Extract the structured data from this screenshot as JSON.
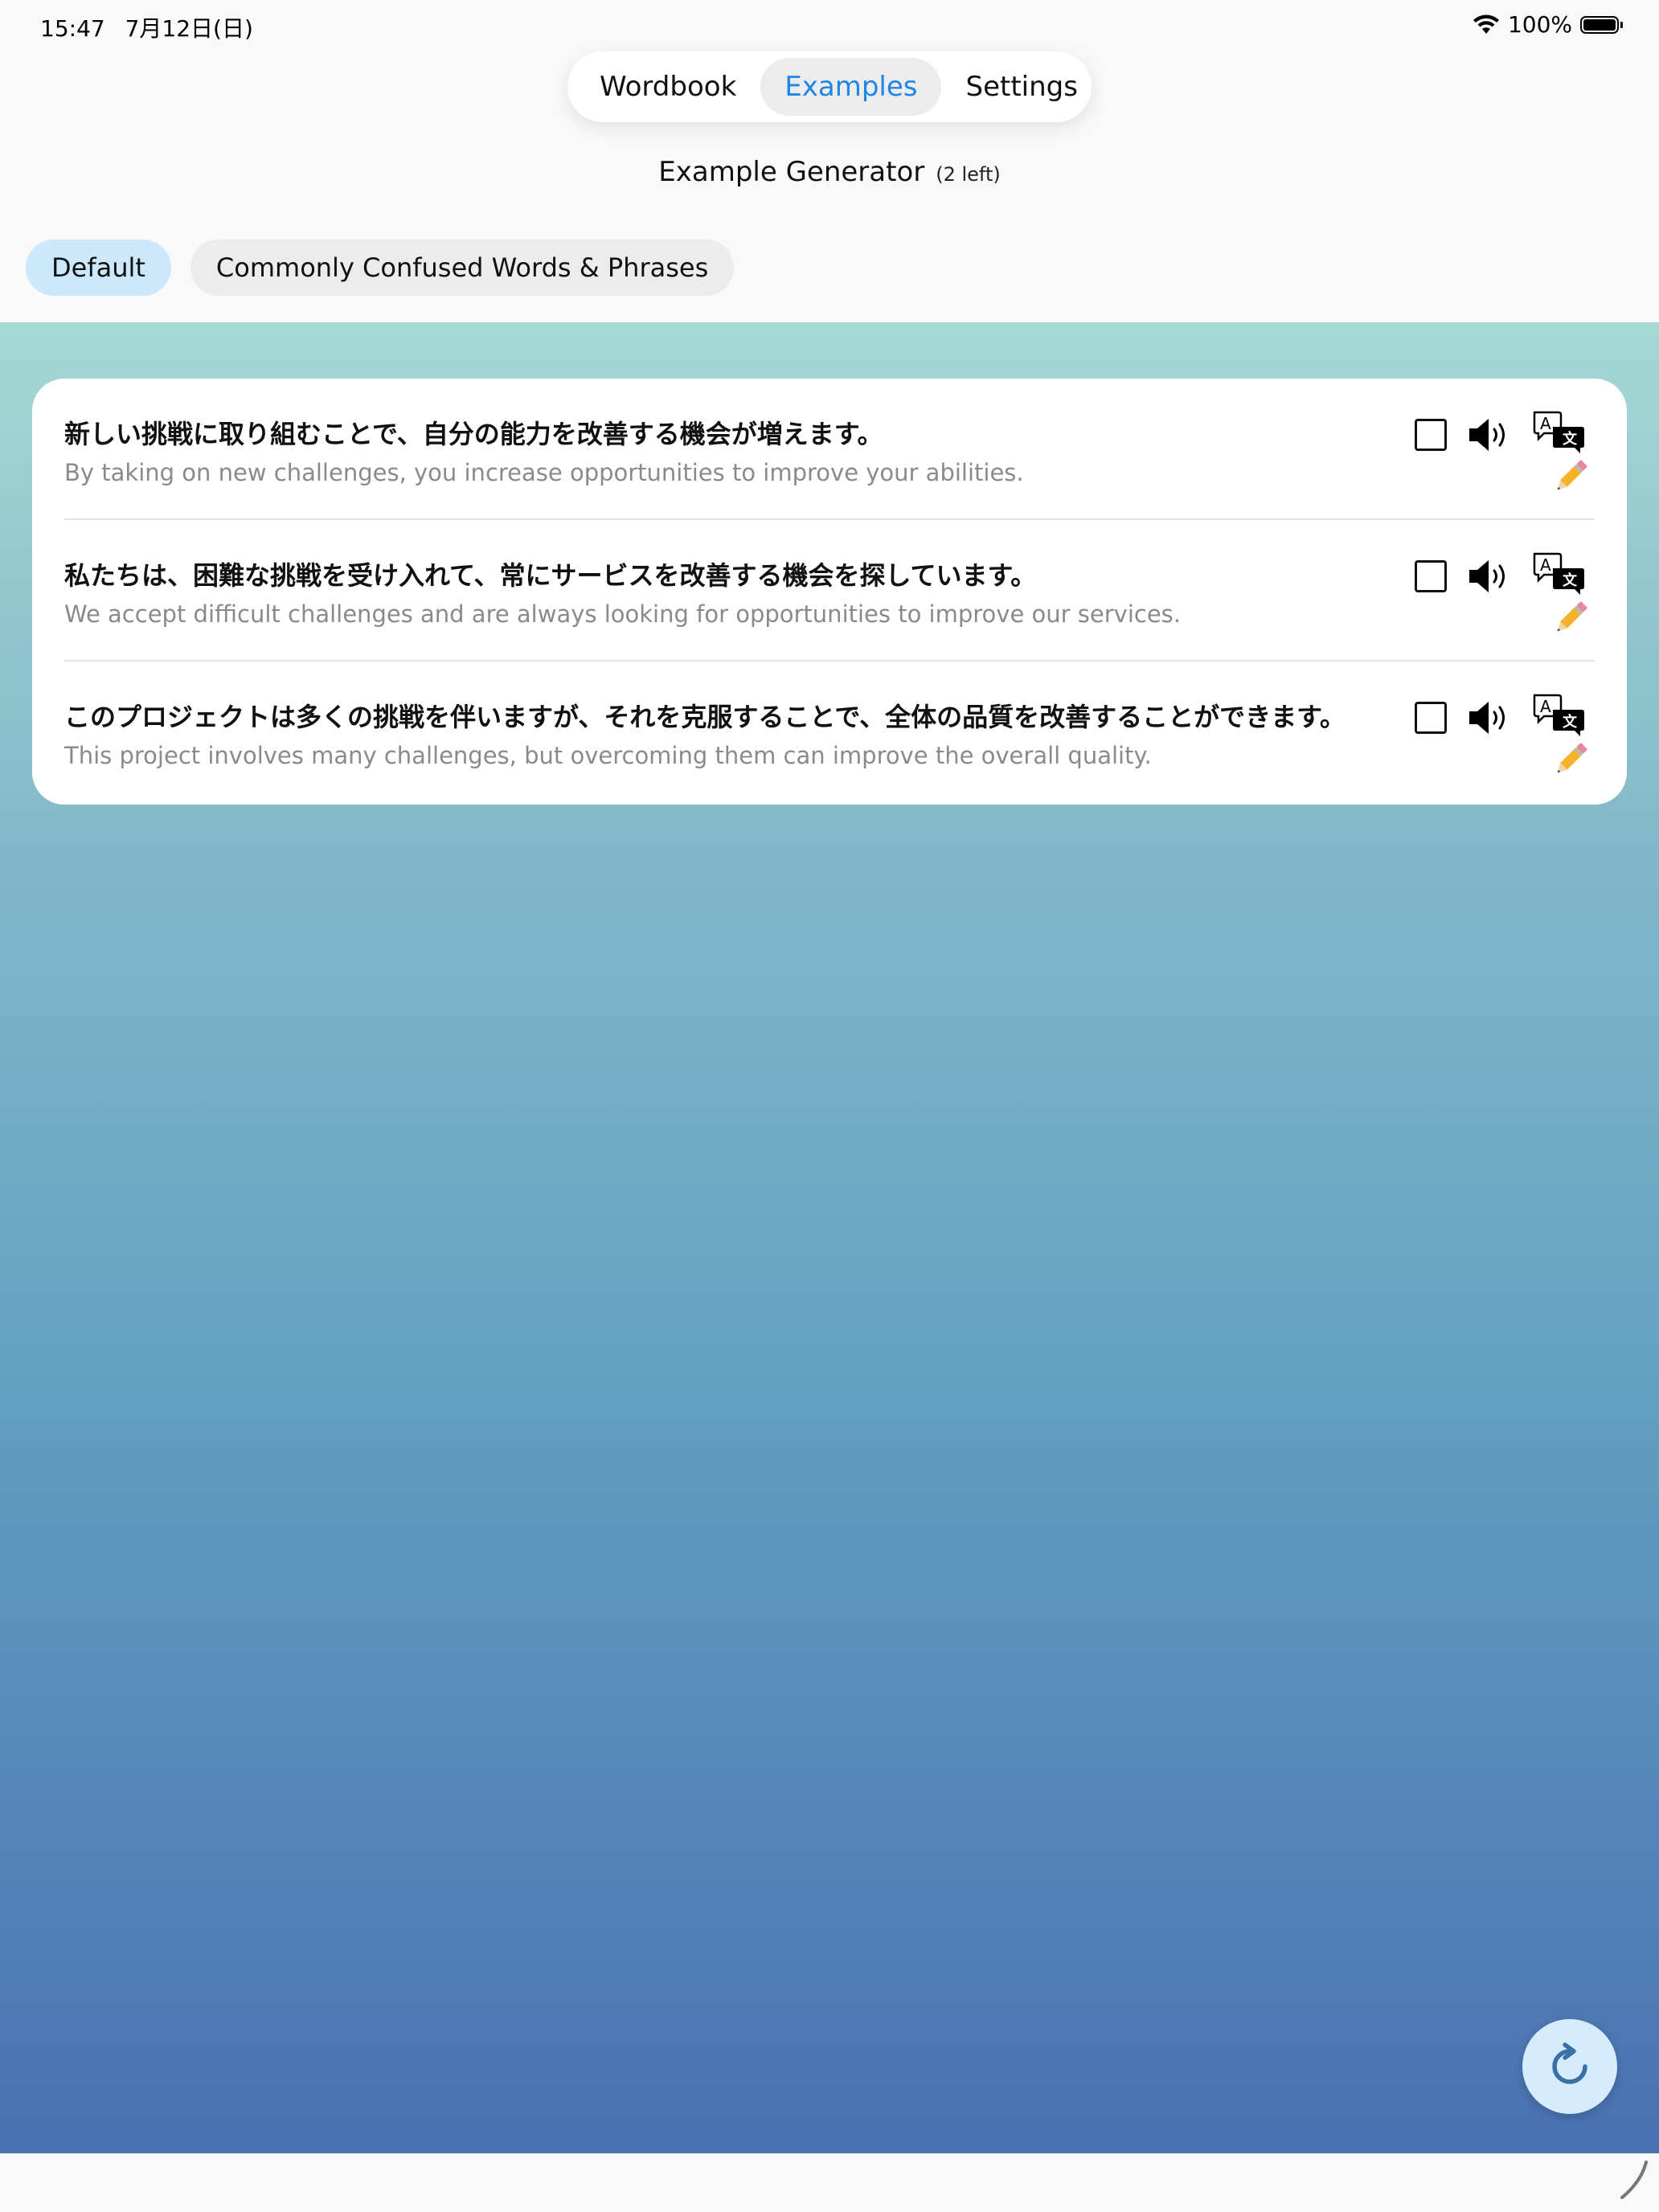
{
  "status_bar": {
    "time": "15:47",
    "date": "7月12日(日)",
    "battery_percent": "100%",
    "wifi_icon": "wifi-icon",
    "battery_icon": "battery-icon"
  },
  "tabs": [
    {
      "label": "Wordbook",
      "active": false
    },
    {
      "label": "Examples",
      "active": true
    },
    {
      "label": "Settings",
      "active": false
    }
  ],
  "header": {
    "title": "Example Generator",
    "remaining": "(2 left)"
  },
  "filters": [
    {
      "label": "Default",
      "active": true
    },
    {
      "label": "Commonly Confused Words & Phrases",
      "active": false
    }
  ],
  "examples": [
    {
      "japanese": "新しい挑戦に取り組むことで、自分の能力を改善する機会が増えます。",
      "english": "By taking on new challenges, you increase opportunities to improve your abilities.",
      "checked": false
    },
    {
      "japanese": "私たちは、困難な挑戦を受け入れて、常にサービスを改善する機会を探しています。",
      "english": "We accept difficult challenges and are always looking for opportunities to improve our services.",
      "checked": false
    },
    {
      "japanese": "このプロジェクトは多くの挑戦を伴いますが、それを克服することで、全体の品質を改善することができます。",
      "english": "This project involves many challenges, but overcoming them can improve the overall quality.",
      "checked": false
    }
  ],
  "row_icons": [
    "checkbox-icon",
    "speaker-icon",
    "translate-icon",
    "pencil-icon"
  ],
  "fab_icon": "refresh-icon",
  "colors": {
    "accent": "#1f86e6",
    "chip_active": "#cde7fb",
    "gradient_top": "#a6d8d4",
    "gradient_bottom": "#4a71b2"
  }
}
